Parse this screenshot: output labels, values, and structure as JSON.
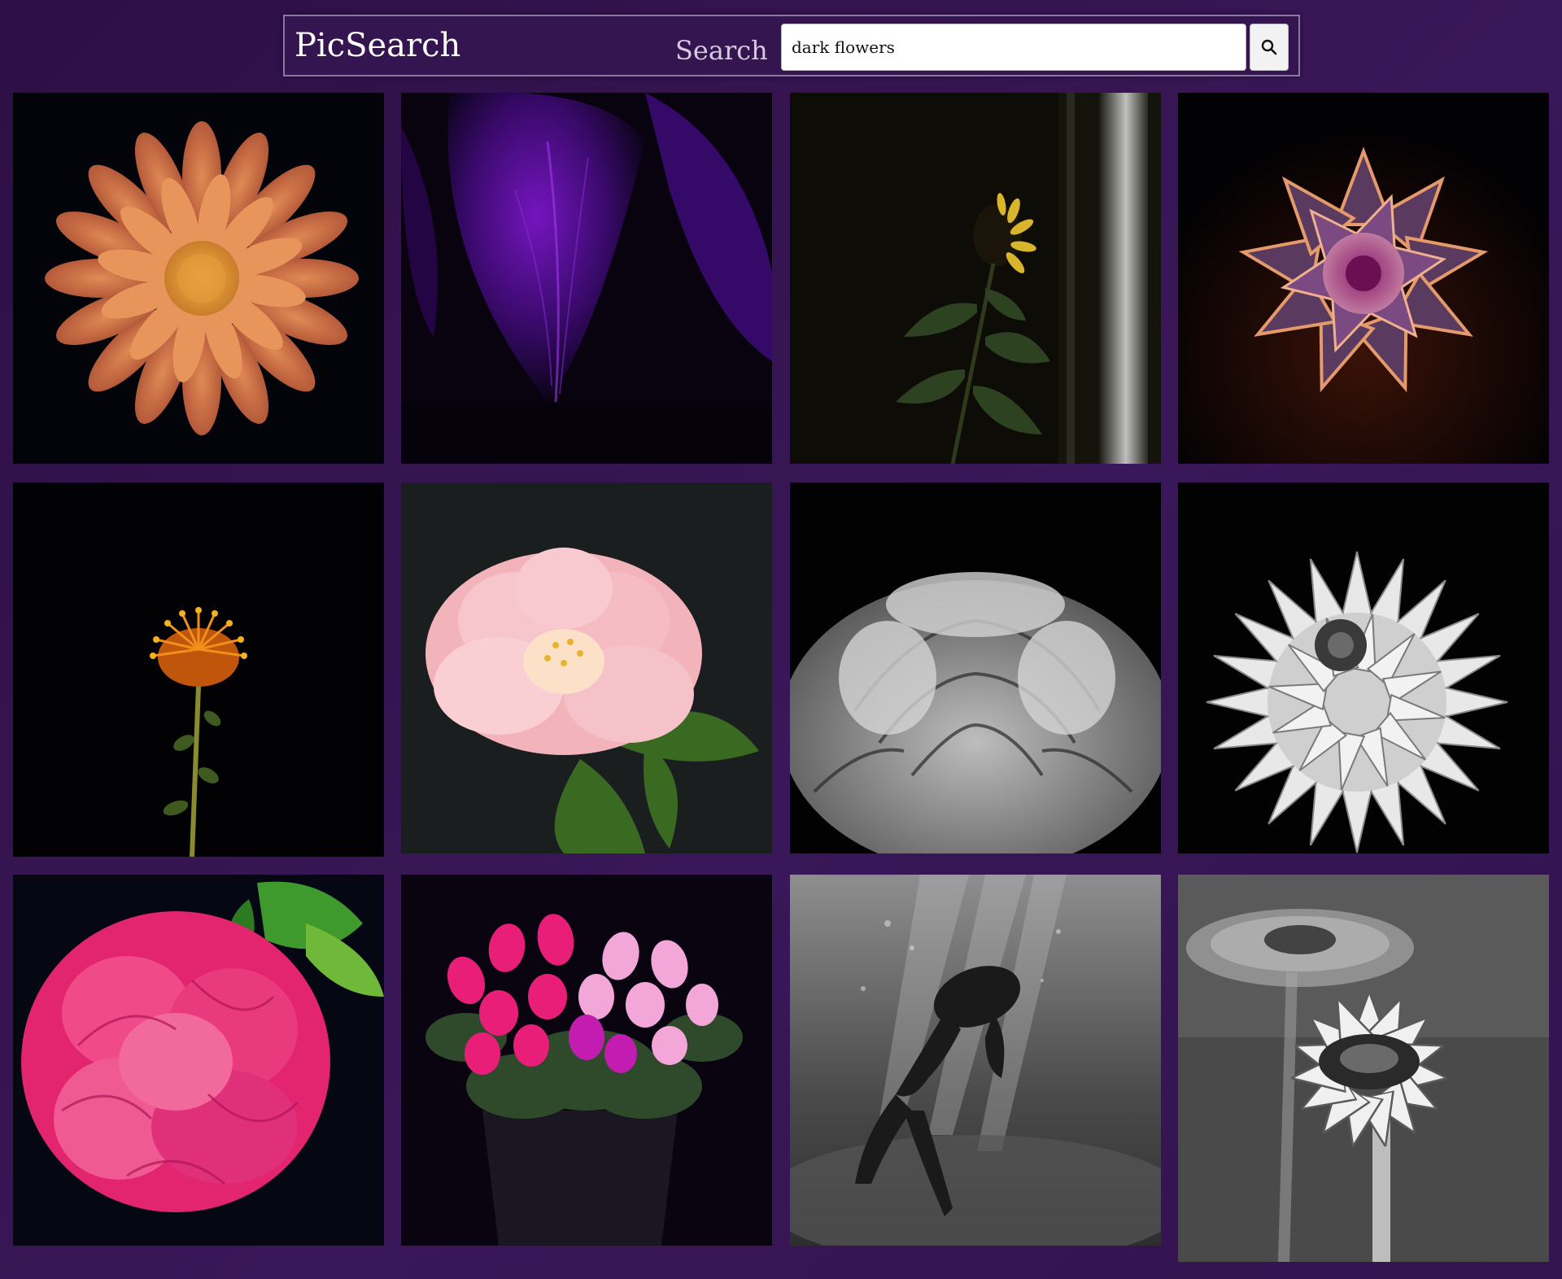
{
  "header": {
    "brand": "PicSearch",
    "search_label": "Search",
    "search_value": "dark flowers",
    "search_button_icon": "search-icon"
  },
  "results": {
    "images": [
      {
        "subject": "orange-gerbera-daisy",
        "icon": "flower-image"
      },
      {
        "subject": "purple-petals-closeup",
        "icon": "flower-image"
      },
      {
        "subject": "sunflower-by-curtain",
        "icon": "flower-image"
      },
      {
        "subject": "succulent-rosette",
        "icon": "flower-image"
      },
      {
        "subject": "orange-pincushion-protea",
        "icon": "flower-image"
      },
      {
        "subject": "pink-camellia",
        "icon": "flower-image"
      },
      {
        "subject": "black-white-rose",
        "icon": "flower-image"
      },
      {
        "subject": "black-white-chrysanthemum",
        "icon": "flower-image"
      },
      {
        "subject": "pink-hibiscus",
        "icon": "flower-image"
      },
      {
        "subject": "pink-cyclamen-pot",
        "icon": "flower-image"
      },
      {
        "subject": "underwater-figure",
        "icon": "photo-image"
      },
      {
        "subject": "black-white-gerberas",
        "icon": "flower-image"
      }
    ]
  },
  "colors": {
    "background": "#3a1758",
    "header_background": "#351550",
    "header_border": "#8a78a6",
    "brand_text": "#ffffff",
    "label_text": "#d6cadf"
  }
}
